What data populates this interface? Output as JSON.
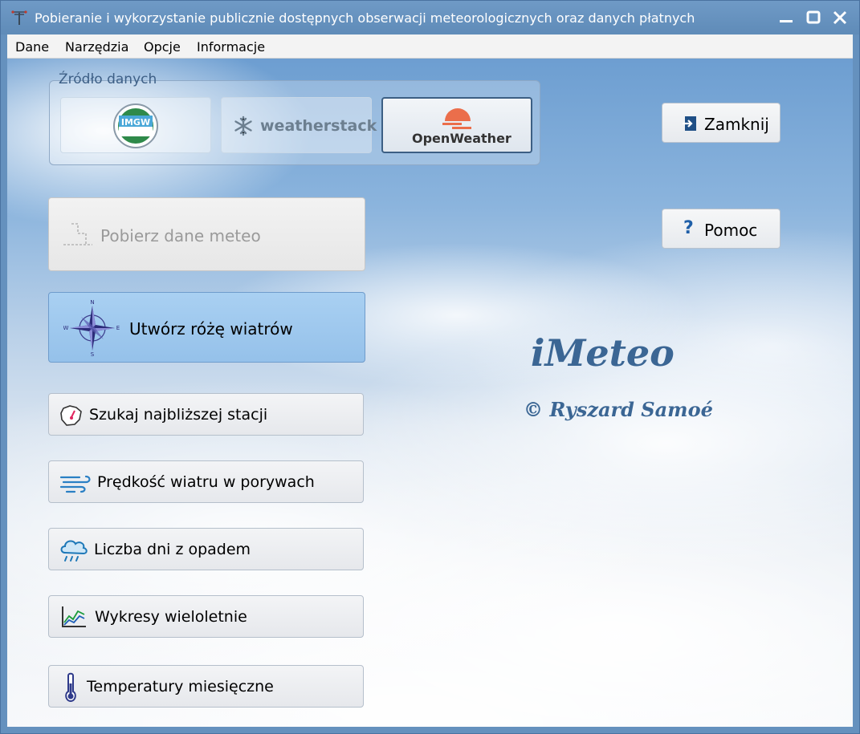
{
  "window": {
    "title": "Pobieranie i wykorzystanie publicznie dostępnych obserwacji meteorologicznych oraz danych płatnych"
  },
  "menu": [
    "Dane",
    "Narzędzia",
    "Opcje",
    "Informacje"
  ],
  "source_group": {
    "label": "Źródło danych",
    "sources": [
      {
        "name": "IMGW",
        "logo_text": "IMGW",
        "selected": false
      },
      {
        "name": "weatherstack",
        "logo_text": "weatherstack",
        "selected": false
      },
      {
        "name": "OpenWeather",
        "logo_text": "OpenWeather",
        "selected": true
      }
    ]
  },
  "buttons": {
    "download_meteo": {
      "label": "Pobierz dane meteo",
      "enabled": false
    },
    "wind_rose": {
      "label": "Utwórz różę wiatrów",
      "compass": {
        "n": "N",
        "e": "E",
        "s": "S",
        "w": "W"
      }
    },
    "tools": [
      {
        "label": "Szukaj najbliższej stacji",
        "icon": "map-pin-icon"
      },
      {
        "label": "Prędkość wiatru w porywach",
        "icon": "wind-icon"
      },
      {
        "label": "Liczba dni z opadem",
        "icon": "rain-cloud-icon"
      },
      {
        "label": "Wykresy wieloletnie",
        "icon": "line-chart-icon"
      },
      {
        "label": "Temperatury miesięczne",
        "icon": "thermometer-icon"
      }
    ],
    "close": {
      "label": "Zamknij"
    },
    "help": {
      "label": "Pomoc"
    }
  },
  "branding": {
    "app_name": "iMeteo",
    "copyright": "© Ryszard Samoé"
  },
  "colors": {
    "accent": "#3b6694",
    "selected_button": "#a9d0f2",
    "titlebar": "#6591be"
  }
}
